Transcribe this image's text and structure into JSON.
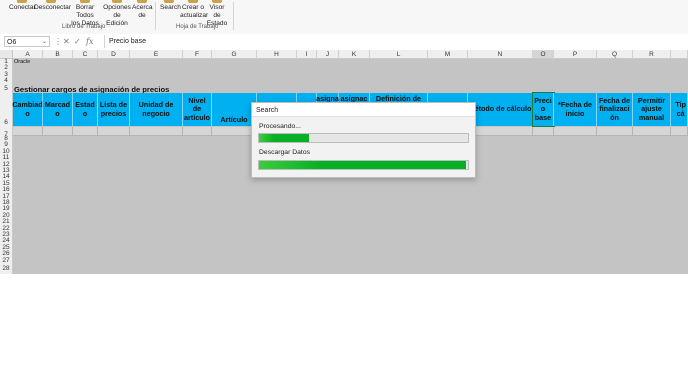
{
  "ribbon": {
    "workbook_group": {
      "label": "Libro de Trabajo",
      "buttons": [
        {
          "lines": [
            "Conectar"
          ]
        },
        {
          "lines": [
            "Desconectar"
          ]
        },
        {
          "lines": [
            "Borrar Todos",
            "los Datos"
          ]
        },
        {
          "lines": [
            "Opciones",
            "de Edición"
          ]
        },
        {
          "lines": [
            "Acerca",
            "de"
          ]
        }
      ]
    },
    "sheet_group": {
      "label": "Hoja de Trabajo",
      "buttons": [
        {
          "lines": [
            "Search"
          ]
        },
        {
          "lines": [
            "Crear o",
            "actualizar"
          ]
        },
        {
          "lines": [
            "Visor de",
            "Estado"
          ]
        }
      ]
    }
  },
  "formula_bar": {
    "name_box": "O6",
    "fx": "fx",
    "formula": "Precio base"
  },
  "columns": [
    "A",
    "B",
    "C",
    "D",
    "E",
    "F",
    "G",
    "H",
    "I",
    "J",
    "K",
    "L",
    "M",
    "N",
    "O",
    "P",
    "Q",
    "R"
  ],
  "rows": [
    "1",
    "2",
    "3",
    "4",
    "5",
    "6",
    "7",
    "8",
    "9",
    "10",
    "11",
    "12",
    "13",
    "14",
    "15",
    "16",
    "17",
    "18",
    "19",
    "20",
    "21",
    "22",
    "23",
    "24",
    "25",
    "26",
    "27",
    "28"
  ],
  "sheet": {
    "brand": "Oracle",
    "title": "Gestionar cargos de asignación de precios",
    "headers": [
      {
        "lines": [
          "Cambiad",
          "o"
        ]
      },
      {
        "lines": [
          "Marcad",
          "o"
        ]
      },
      {
        "lines": [
          "Estad",
          "o"
        ]
      },
      {
        "lines": [
          "Lista de",
          "precios"
        ]
      },
      {
        "lines": [
          "Unidad de",
          "negocio"
        ]
      },
      {
        "lines": [
          "Nivel",
          "de",
          "artículo"
        ]
      },
      {
        "lines": [
          "Artículo"
        ]
      },
      {
        "lines": [
          ""
        ]
      },
      {
        "lines": [
          ""
        ]
      },
      {
        "lines": [
          "asigna"
        ]
      },
      {
        "lines": [
          "asignac"
        ]
      },
      {
        "lines": [
          "Definición de"
        ]
      },
      {
        "lines": [
          ""
        ]
      },
      {
        "lines": [
          "Método de cálculo"
        ]
      },
      {
        "lines": [
          "Preci",
          "o",
          "base"
        ]
      },
      {
        "lines": [
          "*Fecha de",
          "inicio"
        ]
      },
      {
        "lines": [
          "Fecha de",
          "finalizaci",
          "ón"
        ]
      },
      {
        "lines": [
          "Permitir",
          "ajuste",
          "manual"
        ]
      },
      {
        "lines": [
          "Tip",
          "cá"
        ]
      }
    ]
  },
  "dialog": {
    "title": "Search",
    "processing_label": "Procesando...",
    "processing_progress": 0.24,
    "download_label": "Descargar Datos",
    "download_progress": 0.99
  },
  "colors": {
    "header_fill": "#00b0f0",
    "progress_green": "#06b025"
  }
}
